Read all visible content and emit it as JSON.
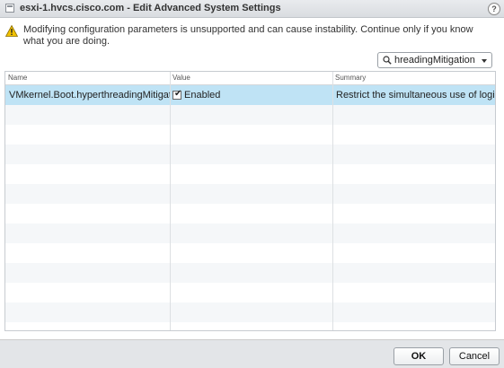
{
  "window": {
    "title": "esxi-1.hvcs.cisco.com - Edit Advanced System Settings",
    "help_label": "?"
  },
  "warning": {
    "text": "Modifying configuration parameters is unsupported and can cause instability. Continue only if you know what you are doing."
  },
  "filter": {
    "value": "hreadingMitigation",
    "icon": "search-icon"
  },
  "grid": {
    "columns": [
      "Name",
      "Value",
      "Summary"
    ],
    "rows": [
      {
        "name": "VMkernel.Boot.hyperthreadingMitigation",
        "value_checked": true,
        "value_label": "Enabled",
        "summary": "Restrict the simultaneous use of logica..."
      }
    ]
  },
  "footer": {
    "ok_label": "OK",
    "cancel_label": "Cancel"
  },
  "colors": {
    "selected_row": "#bfe3f5",
    "warning_icon": "#f2c200"
  }
}
